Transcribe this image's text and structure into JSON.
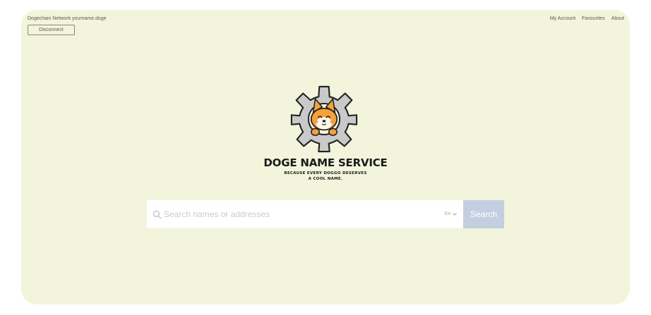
{
  "header": {
    "network_label": "Dogechain Network yourname.doge",
    "disconnect_label": "Disconnect",
    "nav": [
      "My Account",
      "Favourites",
      "About"
    ]
  },
  "brand": {
    "title": "DOGE NAME SERVICE",
    "tagline_line1": "BECAUSE EVERY DOGGO DESERVES",
    "tagline_line2": "A COOL NAME.",
    "logo_icon": "gear-doge-logo"
  },
  "search": {
    "placeholder": "Search names or addresses",
    "language": "EN",
    "button_label": "Search"
  },
  "colors": {
    "panel_bg": "#f2f4dc",
    "search_button": "#c3cfe0",
    "accent_orange": "#f4a23a"
  }
}
